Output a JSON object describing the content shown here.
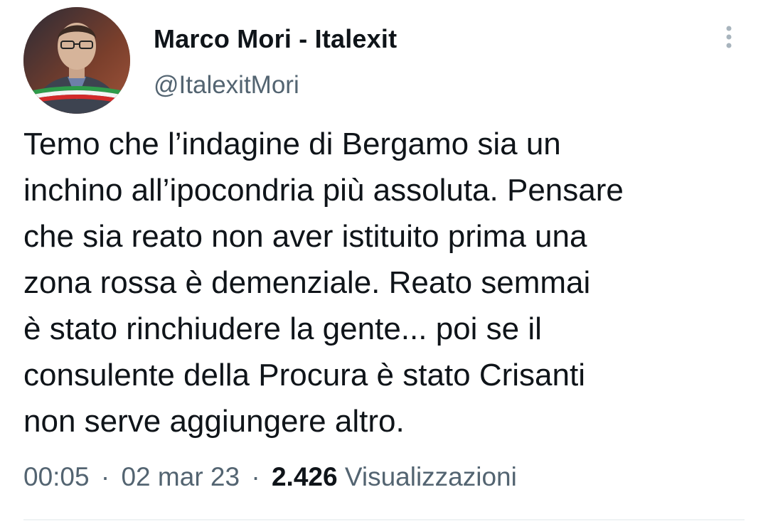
{
  "author": {
    "display_name": "Marco Mori - Italexit",
    "handle": "@ItalexitMori",
    "avatar_icon": "profile-photo"
  },
  "tweet": {
    "lines": [
      "Temo che l’indagine di Bergamo sia un",
      "inchino all’ipocondria più assoluta. Pensare",
      "che sia reato non aver istituito prima una",
      "zona rossa è demenziale. Reato semmai",
      "è stato rinchiudere la gente... poi se il",
      "consulente della Procura è stato Crisanti",
      "non serve aggiungere altro."
    ]
  },
  "meta": {
    "time": "00:05",
    "date": "02 mar 23",
    "views_count": "2.426",
    "views_label": "Visualizzazioni",
    "separator": "·"
  },
  "colors": {
    "text_primary": "#0f1419",
    "text_secondary": "#536471",
    "divider": "#eff3f4"
  }
}
